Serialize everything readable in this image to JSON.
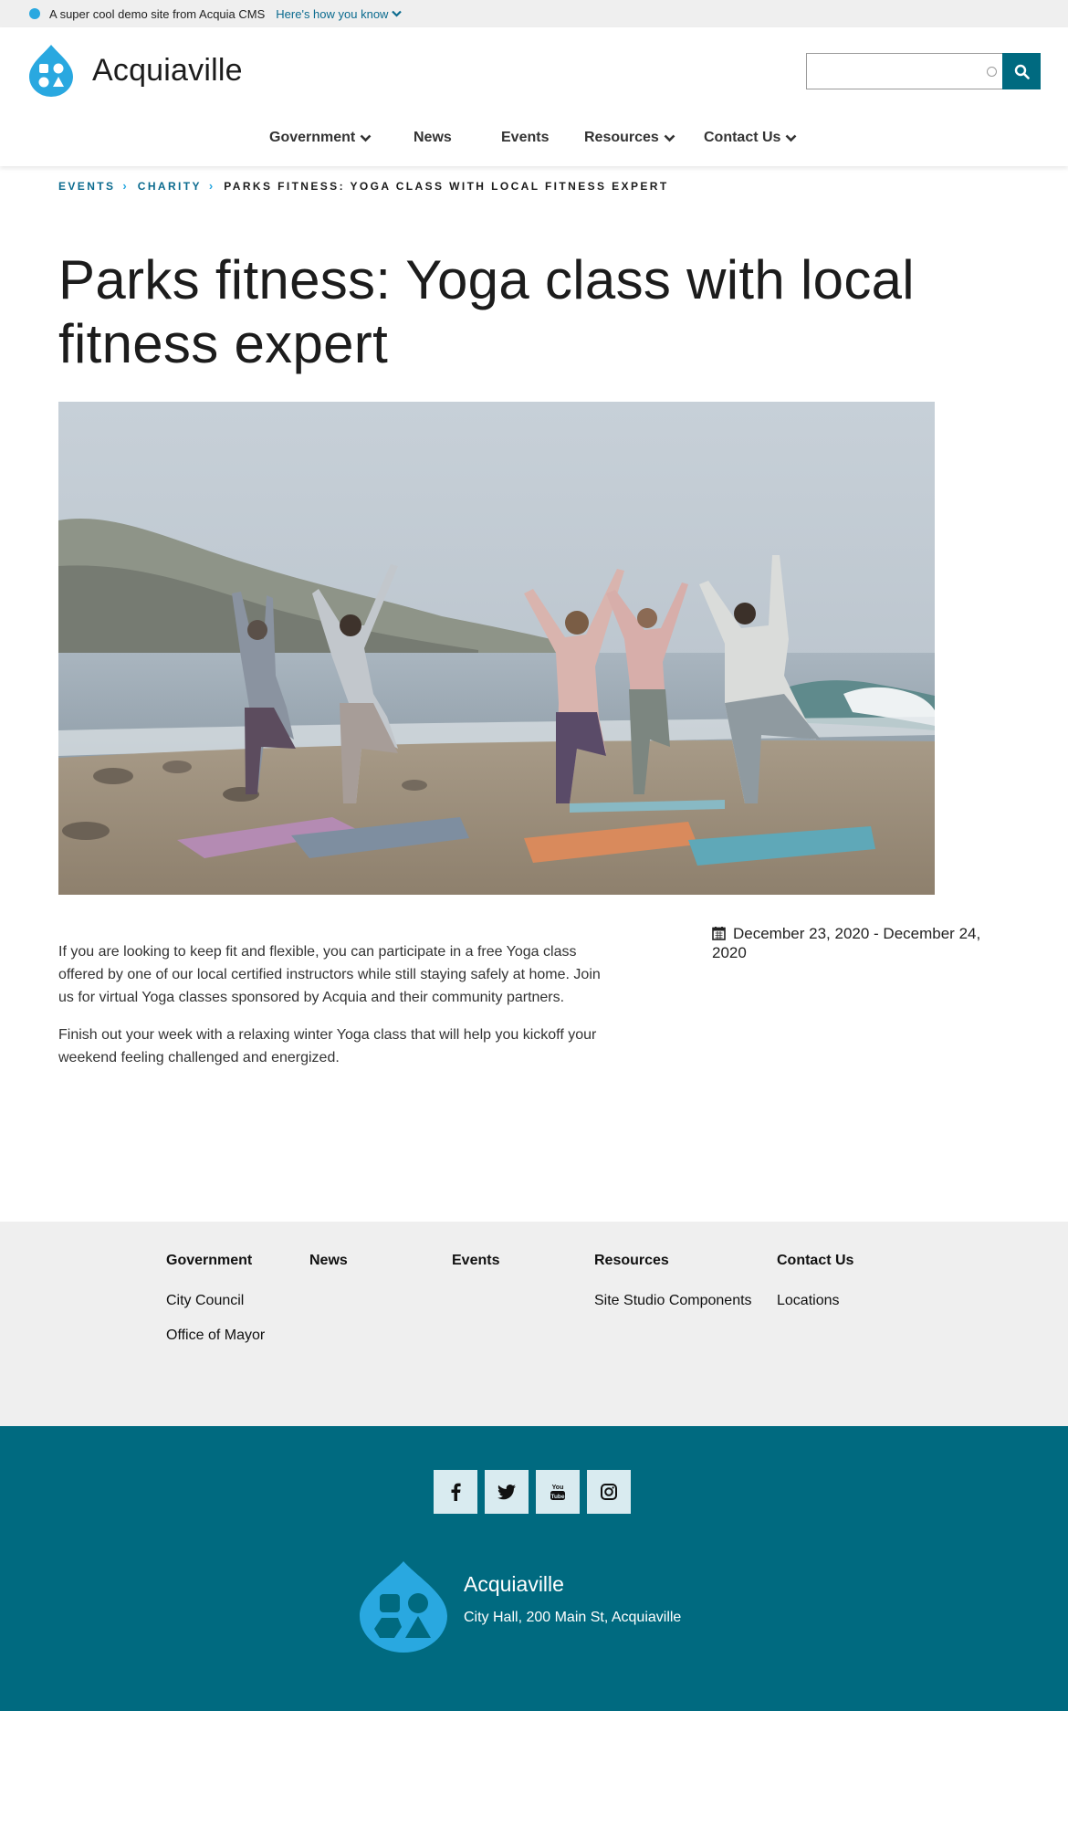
{
  "banner": {
    "message": "A super cool demo site from Acquia CMS",
    "link": "Here's how you know"
  },
  "header": {
    "site_name": "Acquiaville",
    "search": {
      "value": "",
      "placeholder": ""
    }
  },
  "nav": {
    "items": [
      {
        "label": "Government",
        "has_dropdown": true
      },
      {
        "label": "News",
        "has_dropdown": false
      },
      {
        "label": "Events",
        "has_dropdown": false
      },
      {
        "label": "Resources",
        "has_dropdown": true
      },
      {
        "label": "Contact Us",
        "has_dropdown": true
      }
    ]
  },
  "breadcrumb": {
    "items": [
      "EVENTS",
      "CHARITY"
    ],
    "current": "PARKS FITNESS: YOGA CLASS WITH LOCAL FITNESS EXPERT"
  },
  "page": {
    "title": "Parks fitness: Yoga class with local fitness expert",
    "paragraphs": [
      "If you are looking to keep fit and flexible, you can participate in a free Yoga class offered by one of our local certified instructors while still staying safely at home. Join us for virtual Yoga classes sponsored by Acquia and their community partners.",
      "Finish out your week with a relaxing winter Yoga class that will help you kickoff your weekend feeling challenged and energized."
    ],
    "date_range": "December 23, 2020 - December 24, 2020"
  },
  "footer_menu": {
    "columns": [
      {
        "heading": "Government",
        "links": [
          "City Council",
          "Office of Mayor"
        ]
      },
      {
        "heading": "News",
        "links": []
      },
      {
        "heading": "Events",
        "links": []
      },
      {
        "heading": "Resources",
        "links": [
          "Site Studio Components"
        ]
      },
      {
        "heading": "Contact Us",
        "links": [
          "Locations"
        ]
      }
    ]
  },
  "footer": {
    "social": [
      "facebook-icon",
      "twitter-icon",
      "youtube-icon",
      "instagram-icon"
    ],
    "site_name": "Acquiaville",
    "address": "City Hall, 200 Main St, Acquiaville"
  },
  "colors": {
    "brand_blue": "#29a8e0",
    "teal": "#006a80",
    "link": "#0b6b8f",
    "footer_gray": "#efefef"
  }
}
